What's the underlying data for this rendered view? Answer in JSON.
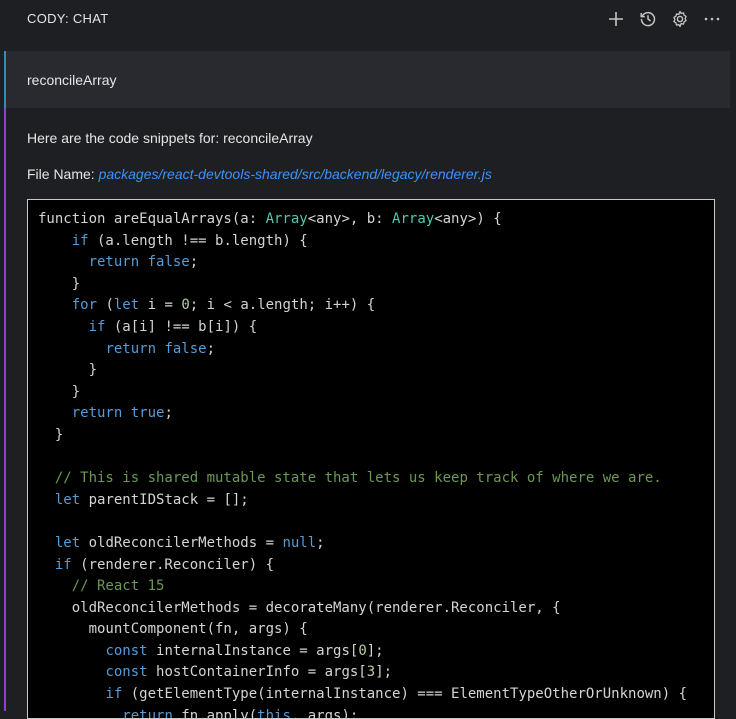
{
  "header": {
    "title": "CODY: CHAT",
    "icons": [
      "plus-icon",
      "history-icon",
      "gear-icon",
      "more-icon"
    ]
  },
  "human": {
    "message": "reconcileArray"
  },
  "assistant": {
    "intro": "Here are the code snippets for: reconcileArray",
    "file_label": "File Name:",
    "file_path": "packages/react-devtools-shared/src/backend/legacy/renderer.js",
    "code_lines": [
      [
        [
          "function areEqualArrays(a: ",
          ""
        ],
        [
          "Array",
          "ty"
        ],
        [
          "<any>, b: ",
          ""
        ],
        [
          "Array",
          "ty"
        ],
        [
          "<any>) {",
          ""
        ]
      ],
      [
        [
          "    ",
          ""
        ],
        [
          "if",
          "kw"
        ],
        [
          " (a.length !== b.length) {",
          ""
        ]
      ],
      [
        [
          "      ",
          ""
        ],
        [
          "return",
          "kw"
        ],
        [
          " ",
          ""
        ],
        [
          "false",
          "kw"
        ],
        [
          ";",
          ""
        ]
      ],
      [
        [
          "    }",
          ""
        ]
      ],
      [
        [
          "    ",
          ""
        ],
        [
          "for",
          "kw"
        ],
        [
          " (",
          ""
        ],
        [
          "let",
          "kw"
        ],
        [
          " i = ",
          ""
        ],
        [
          "0",
          "nm"
        ],
        [
          "; i < a.length; i++) {",
          ""
        ]
      ],
      [
        [
          "      ",
          ""
        ],
        [
          "if",
          "kw"
        ],
        [
          " (a[i] !== b[i]) {",
          ""
        ]
      ],
      [
        [
          "        ",
          ""
        ],
        [
          "return",
          "kw"
        ],
        [
          " ",
          ""
        ],
        [
          "false",
          "kw"
        ],
        [
          ";",
          ""
        ]
      ],
      [
        [
          "      }",
          ""
        ]
      ],
      [
        [
          "    }",
          ""
        ]
      ],
      [
        [
          "    ",
          ""
        ],
        [
          "return",
          "kw"
        ],
        [
          " ",
          ""
        ],
        [
          "true",
          "kw"
        ],
        [
          ";",
          ""
        ]
      ],
      [
        [
          "  }",
          ""
        ]
      ],
      [
        [
          "",
          ""
        ]
      ],
      [
        [
          "  ",
          ""
        ],
        [
          "// This is shared mutable state that lets us keep track of where we are.",
          "cm"
        ]
      ],
      [
        [
          "  ",
          ""
        ],
        [
          "let",
          "kw"
        ],
        [
          " parentIDStack = [];",
          ""
        ]
      ],
      [
        [
          "",
          ""
        ]
      ],
      [
        [
          "  ",
          ""
        ],
        [
          "let",
          "kw"
        ],
        [
          " oldReconcilerMethods = ",
          ""
        ],
        [
          "null",
          "kw"
        ],
        [
          ";",
          ""
        ]
      ],
      [
        [
          "  ",
          ""
        ],
        [
          "if",
          "kw"
        ],
        [
          " (renderer.Reconciler) {",
          ""
        ]
      ],
      [
        [
          "    ",
          ""
        ],
        [
          "// React 15",
          "cm"
        ]
      ],
      [
        [
          "    oldReconcilerMethods = decorateMany(renderer.Reconciler, {",
          ""
        ]
      ],
      [
        [
          "      mountComponent(fn, args) {",
          ""
        ]
      ],
      [
        [
          "        ",
          ""
        ],
        [
          "const",
          "kw"
        ],
        [
          " internalInstance = args[",
          ""
        ],
        [
          "0",
          "nm"
        ],
        [
          "];",
          ""
        ]
      ],
      [
        [
          "        ",
          ""
        ],
        [
          "const",
          "kw"
        ],
        [
          " hostContainerInfo = args[",
          ""
        ],
        [
          "3",
          "nm"
        ],
        [
          "];",
          ""
        ]
      ],
      [
        [
          "        ",
          ""
        ],
        [
          "if",
          "kw"
        ],
        [
          " (getElementType(internalInstance) === ElementTypeOtherOrUnknown) {",
          ""
        ]
      ],
      [
        [
          "          ",
          ""
        ],
        [
          "return",
          "kw"
        ],
        [
          " fn.apply(",
          ""
        ],
        [
          "this",
          "kw"
        ],
        [
          ", args);",
          ""
        ]
      ]
    ]
  }
}
